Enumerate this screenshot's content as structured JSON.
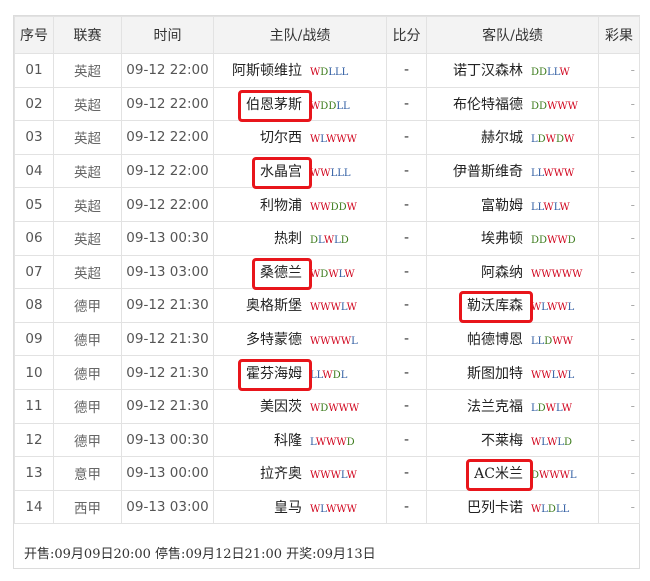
{
  "headers": {
    "idx": "序号",
    "league": "联赛",
    "time": "时间",
    "home": "主队/战绩",
    "score": "比分",
    "away": "客队/战绩",
    "lottery": "彩果"
  },
  "rows": [
    {
      "idx": "01",
      "league": "英超",
      "time": "09-12 22:00",
      "home": "阿斯顿维拉",
      "home_form": "WDLLL",
      "score": "-",
      "away": "诺丁汉森林",
      "away_form": "DDLLW",
      "lottery": "-",
      "home_hl": false,
      "away_hl": false
    },
    {
      "idx": "02",
      "league": "英超",
      "time": "09-12 22:00",
      "home": "伯恩茅斯",
      "home_form": "WDDLL",
      "score": "-",
      "away": "布伦特福德",
      "away_form": "DDWWW",
      "lottery": "-",
      "home_hl": true,
      "away_hl": false
    },
    {
      "idx": "03",
      "league": "英超",
      "time": "09-12 22:00",
      "home": "切尔西",
      "home_form": "WLWWW",
      "score": "-",
      "away": "赫尔城",
      "away_form": "LDWDW",
      "lottery": "-",
      "home_hl": false,
      "away_hl": false
    },
    {
      "idx": "04",
      "league": "英超",
      "time": "09-12 22:00",
      "home": "水晶宫",
      "home_form": "WWLLL",
      "score": "-",
      "away": "伊普斯维奇",
      "away_form": "LLWWW",
      "lottery": "-",
      "home_hl": true,
      "away_hl": false
    },
    {
      "idx": "05",
      "league": "英超",
      "time": "09-12 22:00",
      "home": "利物浦",
      "home_form": "WWDDW",
      "score": "-",
      "away": "富勒姆",
      "away_form": "LLWLW",
      "lottery": "-",
      "home_hl": false,
      "away_hl": false
    },
    {
      "idx": "06",
      "league": "英超",
      "time": "09-13 00:30",
      "home": "热刺",
      "home_form": "DLWLD",
      "score": "-",
      "away": "埃弗顿",
      "away_form": "DDWWD",
      "lottery": "-",
      "home_hl": false,
      "away_hl": false
    },
    {
      "idx": "07",
      "league": "英超",
      "time": "09-13 03:00",
      "home": "桑德兰",
      "home_form": "WDWLW",
      "score": "-",
      "away": "阿森纳",
      "away_form": "WWWWW",
      "lottery": "-",
      "home_hl": true,
      "away_hl": false
    },
    {
      "idx": "08",
      "league": "德甲",
      "time": "09-12 21:30",
      "home": "奥格斯堡",
      "home_form": "WWWLW",
      "score": "-",
      "away": "勒沃库森",
      "away_form": "WLWWL",
      "lottery": "-",
      "home_hl": false,
      "away_hl": true
    },
    {
      "idx": "09",
      "league": "德甲",
      "time": "09-12 21:30",
      "home": "多特蒙德",
      "home_form": "WWWWL",
      "score": "-",
      "away": "帕德博恩",
      "away_form": "LLDWW",
      "lottery": "-",
      "home_hl": false,
      "away_hl": false
    },
    {
      "idx": "10",
      "league": "德甲",
      "time": "09-12 21:30",
      "home": "霍芬海姆",
      "home_form": "LLWDL",
      "score": "-",
      "away": "斯图加特",
      "away_form": "WWLWL",
      "lottery": "-",
      "home_hl": true,
      "away_hl": false
    },
    {
      "idx": "11",
      "league": "德甲",
      "time": "09-12 21:30",
      "home": "美因茨",
      "home_form": "WDWWW",
      "score": "-",
      "away": "法兰克福",
      "away_form": "LDWLW",
      "lottery": "-",
      "home_hl": false,
      "away_hl": false
    },
    {
      "idx": "12",
      "league": "德甲",
      "time": "09-13 00:30",
      "home": "科隆",
      "home_form": "LWWWD",
      "score": "-",
      "away": "不莱梅",
      "away_form": "WLWLD",
      "lottery": "-",
      "home_hl": false,
      "away_hl": false
    },
    {
      "idx": "13",
      "league": "意甲",
      "time": "09-13 00:00",
      "home": "拉齐奥",
      "home_form": "WWWLW",
      "score": "-",
      "away": "AC米兰",
      "away_form": "DWWWL",
      "lottery": "-",
      "home_hl": false,
      "away_hl": true
    },
    {
      "idx": "14",
      "league": "西甲",
      "time": "09-13 03:00",
      "home": "皇马",
      "home_form": "WLWWW",
      "score": "-",
      "away": "巴列卡诺",
      "away_form": "WLDLL",
      "lottery": "-",
      "home_hl": false,
      "away_hl": false
    }
  ],
  "footer": "开售:09月09日20:00 停售:09月12日21:00 开奖:09月13日",
  "colors": {
    "win": "#d0021b",
    "draw": "#3a7a1a",
    "loss": "#2c5aa0",
    "highlight": "#e8151b",
    "header_bg": "#f3f3f3"
  }
}
